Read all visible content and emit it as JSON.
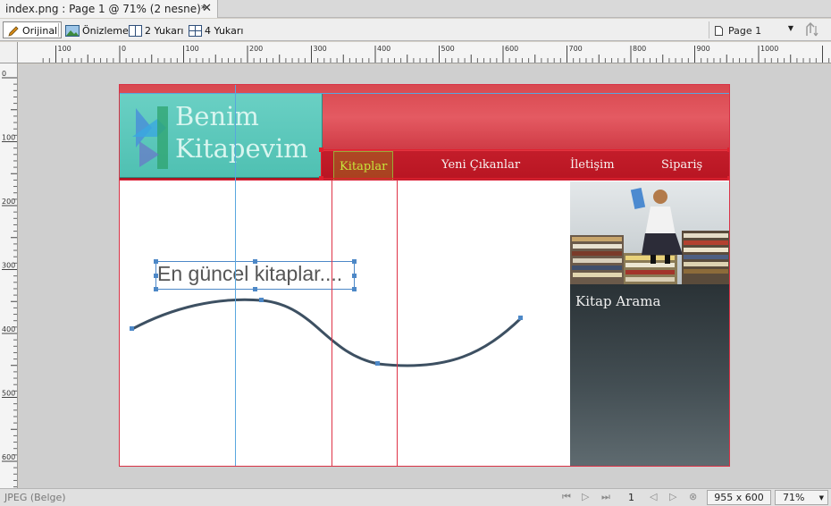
{
  "document_tab": {
    "title": "index.png : Page 1 @  71% (2 nesne)*",
    "close_glyph": "✕"
  },
  "toolbar": {
    "original_label": "Orijinal",
    "preview_label": "Önizleme",
    "two_up_label": "2 Yukarı",
    "four_up_label": "4 Yukarı",
    "page_label": "Page 1"
  },
  "rulers": {
    "horizontal_labels": [
      "100",
      "0",
      "100",
      "200",
      "300",
      "400",
      "500",
      "600",
      "700",
      "800",
      "900",
      "1000"
    ],
    "vertical_labels": [
      "0",
      "100",
      "200",
      "300",
      "400",
      "500",
      "600"
    ]
  },
  "page": {
    "logo_text_line1": "Benim",
    "logo_text_line2": "Kitapevim",
    "nav": [
      "Kitaplar",
      "Yeni Çıkanlar",
      "İletişim",
      "Sipariş"
    ],
    "headline": "En güncel kitaplar....",
    "sidebar_title": "Kitap Arama"
  },
  "status": {
    "file_type": "JPEG (Belge)",
    "page_number": "1",
    "image_size": "955 x 600",
    "zoom": "71%"
  },
  "colors": {
    "header_red": "#d8484f",
    "logo_teal": "#5cc8bb",
    "guide_blue": "#58a6df",
    "slice_red": "#df3347"
  }
}
